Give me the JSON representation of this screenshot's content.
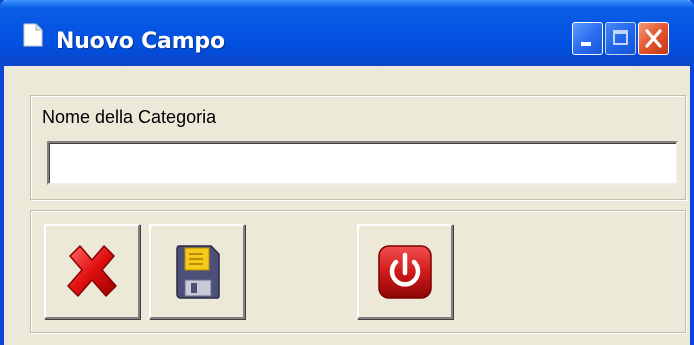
{
  "window": {
    "title": "Nuovo Campo",
    "icons": {
      "title_icon": "document-icon",
      "minimize": "minimize-icon",
      "maximize": "maximize-icon",
      "close": "close-icon"
    }
  },
  "form": {
    "category_label": "Nome della Categoria",
    "category_value": "",
    "category_placeholder": ""
  },
  "actions": {
    "cancel_icon": "red-x-icon",
    "save_icon": "floppy-disk-icon",
    "exit_icon": "power-icon"
  },
  "colors": {
    "titlebar": "#0554e3",
    "close_button": "#e2552e",
    "window_bg": "#ece9d8",
    "power_red": "#d11a1a"
  }
}
